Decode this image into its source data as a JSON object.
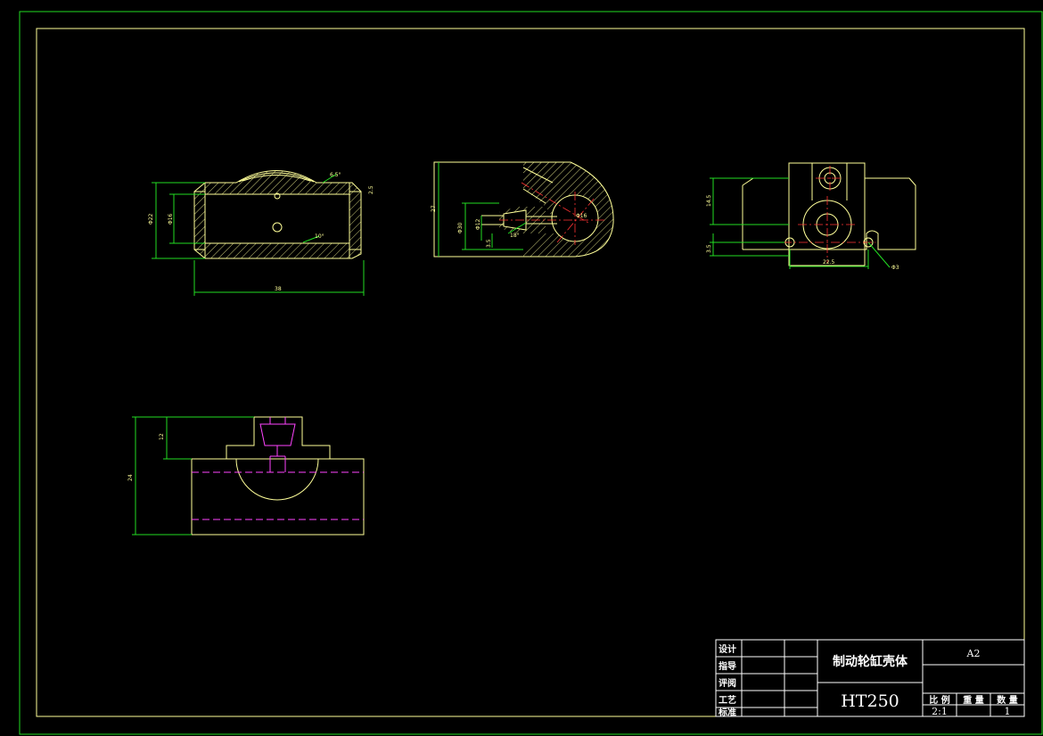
{
  "drawing": {
    "views": {
      "front": {
        "dims": {
          "overall_width": "38",
          "dia_outer": "Φ22",
          "dia_inner": "Φ16",
          "slope": "6.5°",
          "chamfer": "10°",
          "edge": "2.5"
        }
      },
      "section": {
        "dims": {
          "height": "27",
          "dia_bore": "Φ30",
          "dia_small": "Φ12",
          "dia_cone": "Φ16",
          "small_len": "3.5",
          "slope": "18°"
        }
      },
      "side": {
        "dims": {
          "height_upper": "14.5",
          "height_lower": "3.5",
          "width": "22.5",
          "hole": "Φ3"
        }
      },
      "bottom": {
        "dims": {
          "height": "24",
          "offset": "12"
        }
      }
    },
    "title_block": {
      "roles": [
        "设计",
        "指导",
        "评阅",
        "工艺",
        "标准"
      ],
      "part_name": "制动轮缸壳体",
      "material": "HT250",
      "sheet_size": "A2",
      "headers": {
        "scale": "比 例",
        "weight": "重 量",
        "quantity": "数 量"
      },
      "values": {
        "scale": "2:1",
        "weight": "",
        "quantity": "1"
      }
    }
  }
}
